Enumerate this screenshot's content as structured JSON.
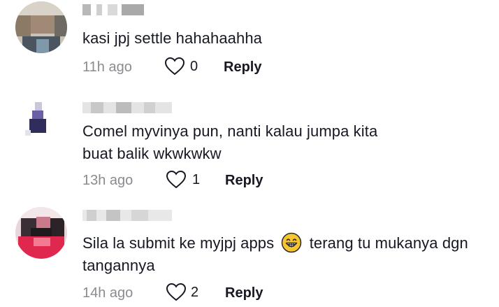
{
  "comments": [
    {
      "text": "kasi jpj settle hahahaahha",
      "time": "11h ago",
      "likes": "0",
      "reply_label": "Reply"
    },
    {
      "text": "Comel myvinya pun, nanti kalau jumpa kita buat balik wkwkwkw",
      "time": "13h ago",
      "likes": "1",
      "reply_label": "Reply"
    },
    {
      "text_before_emoji": "Sila la submit ke myjpj apps",
      "emoji": "grinning-face-with-teeth",
      "text_after_emoji": "terang tu mukanya dgn tangannya",
      "time": "14h ago",
      "likes": "2",
      "reply_label": "Reply"
    }
  ],
  "colors": {
    "text": "#161823",
    "muted": "#8a8b91",
    "emoji_yellow": "#f7c531"
  }
}
